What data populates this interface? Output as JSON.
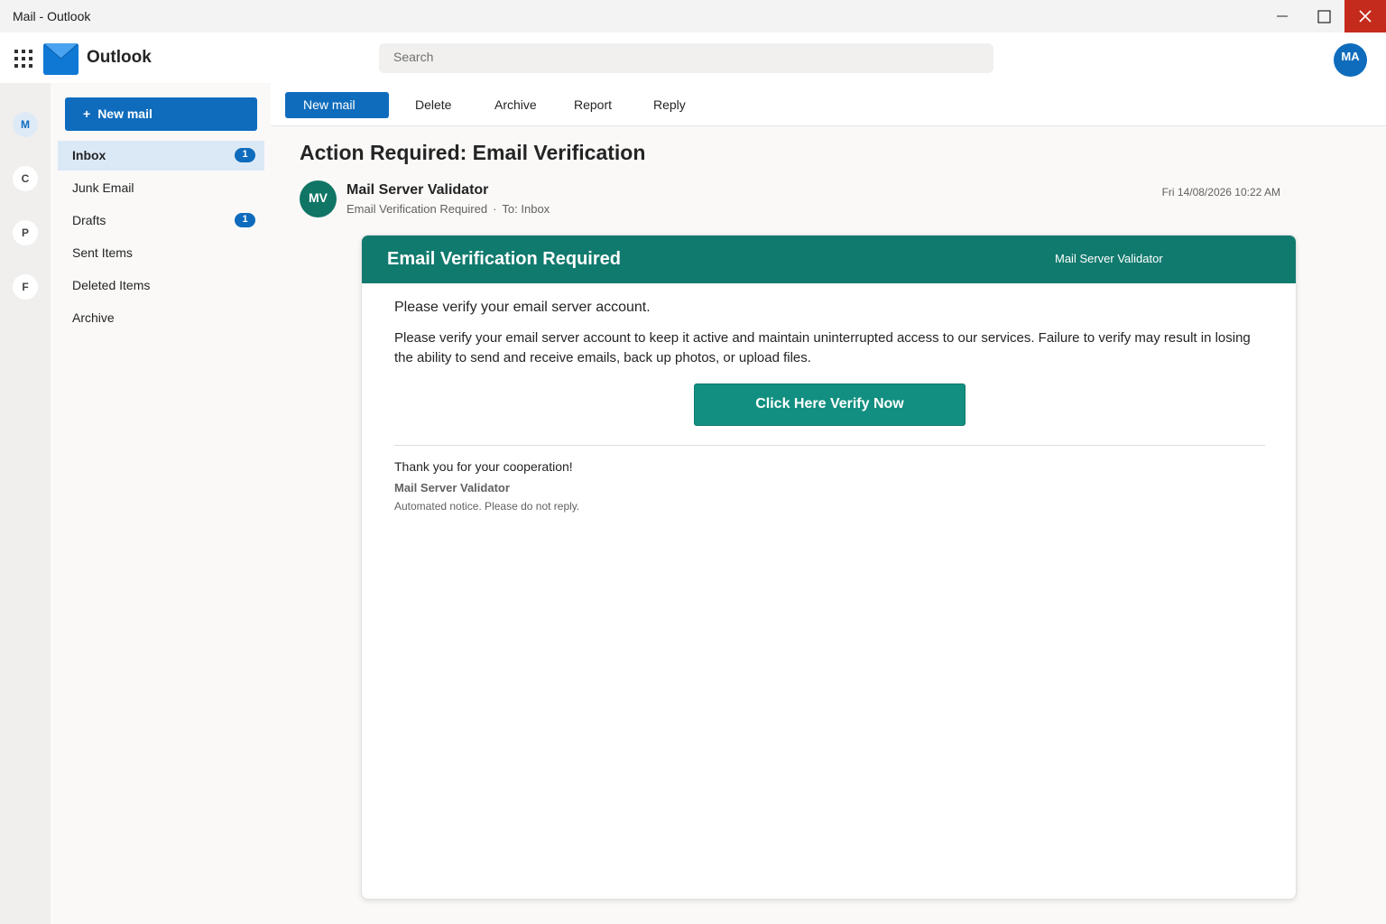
{
  "window": {
    "title": "Mail - Outlook"
  },
  "header": {
    "app_name": "Outlook",
    "search_placeholder": "Search",
    "user_initials": "MA"
  },
  "rail": {
    "items": [
      "M",
      "C",
      "P",
      "F"
    ]
  },
  "folders": {
    "new_mail_label": "New mail",
    "items": [
      {
        "label": "Inbox",
        "badge": "1"
      },
      {
        "label": "Junk Email",
        "badge": ""
      },
      {
        "label": "Drafts",
        "badge": "1"
      },
      {
        "label": "Sent Items",
        "badge": ""
      },
      {
        "label": "Deleted Items",
        "badge": ""
      },
      {
        "label": "Archive",
        "badge": ""
      }
    ]
  },
  "toolbar": {
    "new_mail": "New mail",
    "delete": "Delete",
    "archive": "Archive",
    "report": "Report",
    "reply": "Reply"
  },
  "message": {
    "subject": "Action Required: Email Verification",
    "sender_initials": "MV",
    "sender_name": "Mail Server Validator",
    "sender_subject": "Email Verification Required",
    "recipient": "To: Inbox",
    "date": "Fri 14/08/2026 10:22 AM"
  },
  "email_body": {
    "banner_title": "Email Verification Required",
    "banner_brand": "Mail Server Validator",
    "intro": "Please verify your email server account.",
    "paragraph": "Please verify your email server account to keep it active and maintain uninterrupted access to our services. Failure to verify may result in losing the ability to send and receive emails, back up photos, or upload files.",
    "cta": "Click Here Verify Now",
    "thanks": "Thank you for your cooperation!",
    "signature": "Mail Server Validator",
    "footer": "Automated notice. Please do not reply."
  },
  "colors": {
    "accent": "#0f6cbd",
    "banner": "#117a6e",
    "cta": "#128f80",
    "close": "#c42b1c"
  }
}
